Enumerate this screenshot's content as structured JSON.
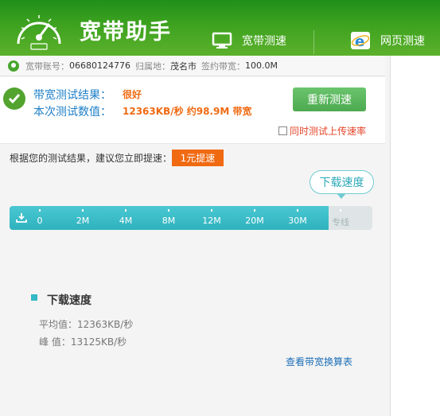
{
  "header": {
    "title": "宽带助手",
    "tabs": [
      {
        "label": "宽带测速",
        "icon": "monitor-icon"
      },
      {
        "label": "网页测速",
        "icon": "ie-browser-icon"
      }
    ],
    "colors": {
      "green_top": "#1f8f1a",
      "green_bottom": "#5cb12b"
    }
  },
  "account": {
    "account_label": "宽带账号：",
    "account_value": "06680124776",
    "location_label": "归属地：",
    "location_value": "茂名市",
    "contract_label": "签约带宽：",
    "contract_value": "100.0M"
  },
  "result": {
    "label1": "带宽测试结果：",
    "value1": "很好",
    "label2": "本次测试数值：",
    "value2": "12363KB/秒 约98.9M 带宽",
    "retest_button": "重新测速",
    "sync_upload": "同时测试上传速率",
    "sync_checked": false
  },
  "advice": {
    "text": "根据您的测试结果，建议您立即提速：",
    "boost_button": "1元提速"
  },
  "speed": {
    "bubble": "下载速度",
    "ticks": [
      "0",
      "2M",
      "4M",
      "8M",
      "12M",
      "20M",
      "30M",
      "专线"
    ],
    "fill_fraction": 0.88,
    "colors": {
      "fill": "#33b8c6",
      "track": "#dfe5e7"
    }
  },
  "stats": {
    "title": "下载速度",
    "avg": "平均值：12363KB/秒",
    "peak": "峰  值：13125KB/秒",
    "conversion_link": "查看带宽换算表"
  }
}
